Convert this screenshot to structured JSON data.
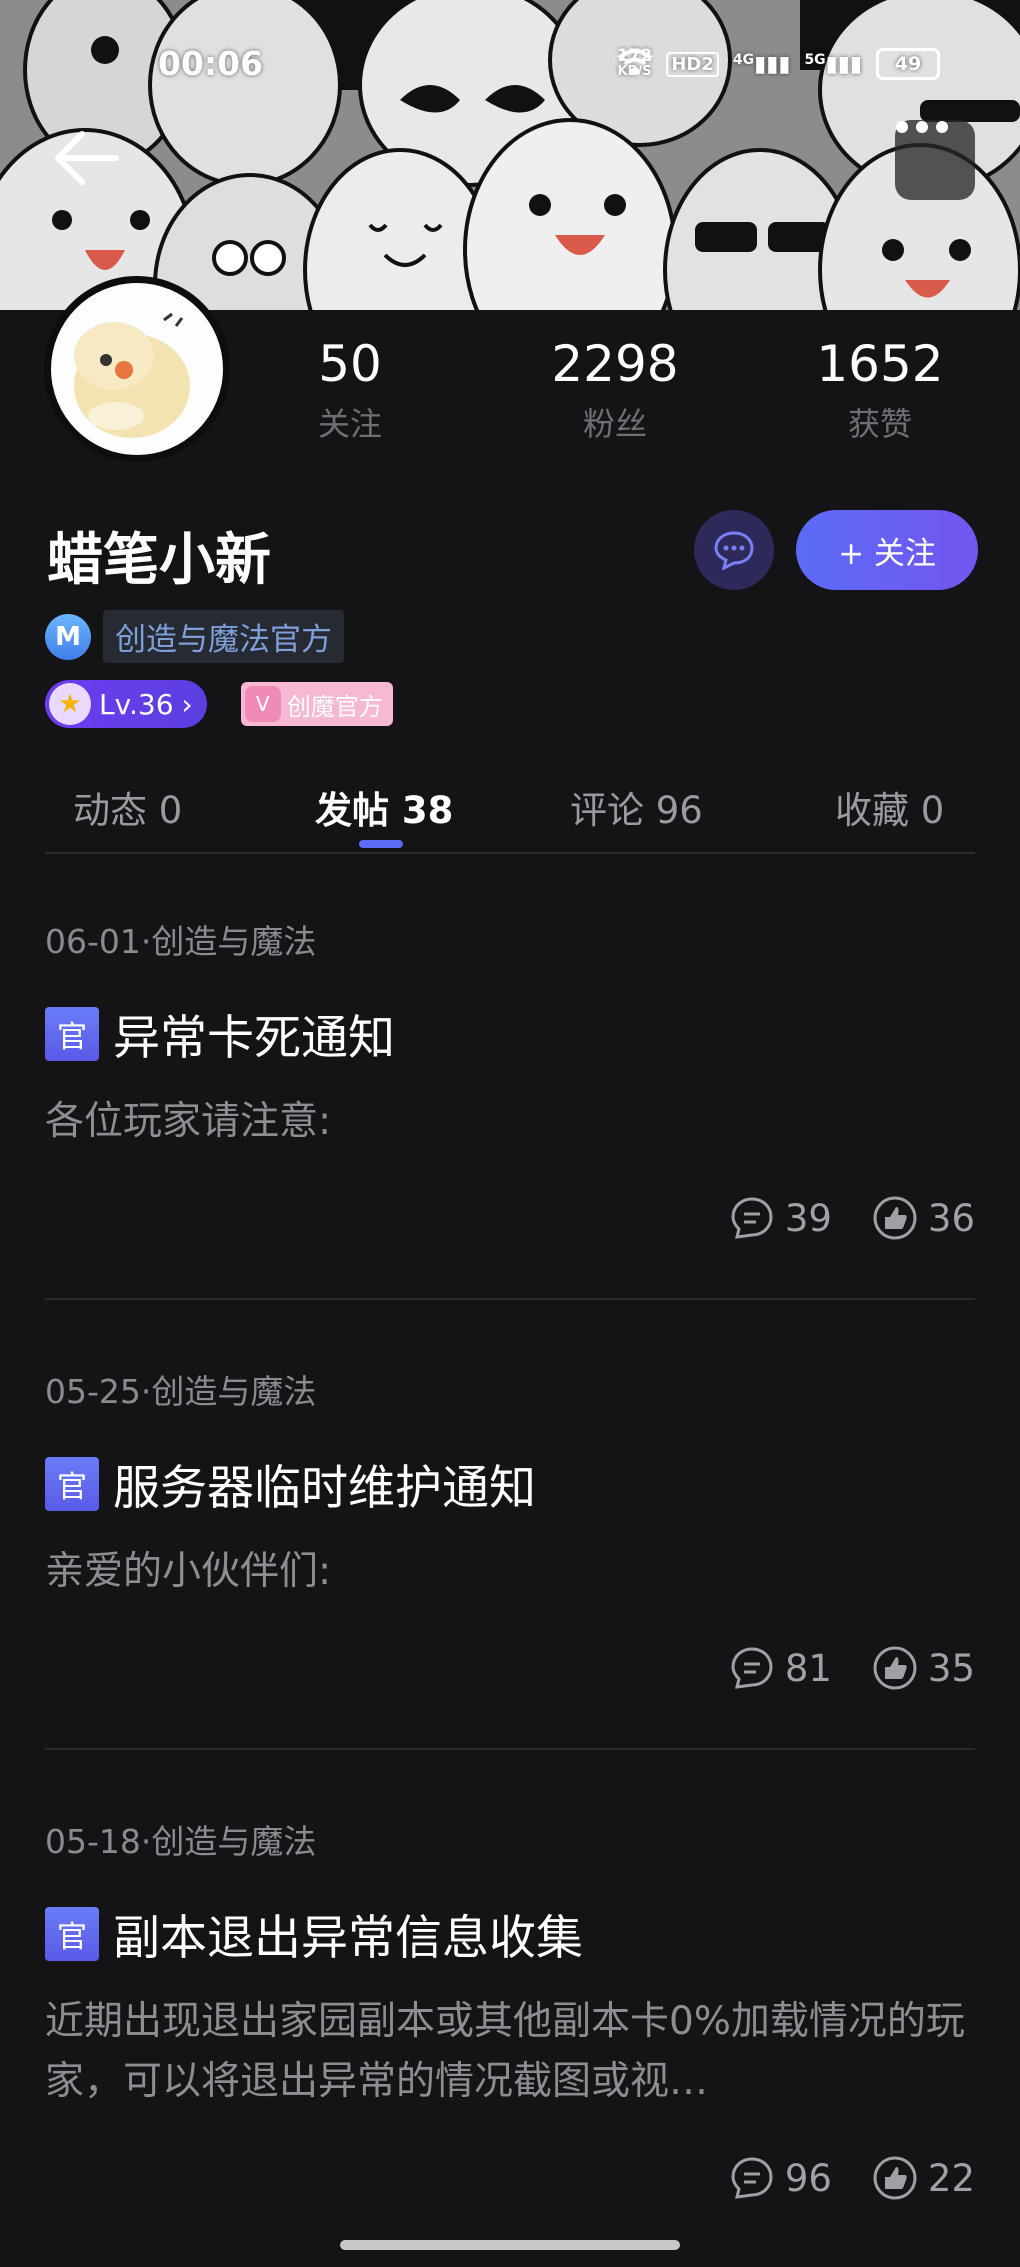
{
  "status_bar": {
    "time": "00:06",
    "net_speed_value": "172",
    "net_speed_unit": "KB/S",
    "hd_label": "HD2",
    "net_4g": "4G",
    "net_5g": "5G",
    "battery": "49"
  },
  "profile": {
    "stats": [
      {
        "value": "50",
        "label": "关注"
      },
      {
        "value": "2298",
        "label": "粉丝"
      },
      {
        "value": "1652",
        "label": "获赞"
      }
    ],
    "username": "蜡笔小新",
    "follow_label": "+ 关注",
    "org": {
      "icon_letter": "M",
      "label": "创造与魔法官方"
    },
    "level_label": "Lv.36",
    "official_badge": "创魔官方"
  },
  "tabs": [
    {
      "label": "动态 0",
      "active": false
    },
    {
      "label": "发帖 38",
      "active": true
    },
    {
      "label": "评论 96",
      "active": false
    },
    {
      "label": "收藏 0",
      "active": false
    }
  ],
  "posts": [
    {
      "meta": "06-01·创造与魔法",
      "badge": "官",
      "title": "异常卡死通知",
      "excerpt": "各位玩家请注意:",
      "comments": "39",
      "likes": "36"
    },
    {
      "meta": "05-25·创造与魔法",
      "badge": "官",
      "title": "服务器临时维护通知",
      "excerpt": "亲爱的小伙伴们:",
      "comments": "81",
      "likes": "35"
    },
    {
      "meta": "05-18·创造与魔法",
      "badge": "官",
      "title": "副本退出异常信息收集",
      "excerpt": "近期出现退出家园副本或其他副本卡0%加载情况的玩家，可以将退出异常的情况截图或视…",
      "comments": "96",
      "likes": "22"
    }
  ],
  "colors": {
    "accent": "#5b6bf5",
    "background": "#141416",
    "muted_text": "#8a8a90"
  },
  "icons": {
    "back": "arrow-left-icon",
    "more": "more-horizontal-icon",
    "chat": "chat-bubble-icon",
    "comment": "comment-icon",
    "like": "thumbs-up-icon"
  }
}
